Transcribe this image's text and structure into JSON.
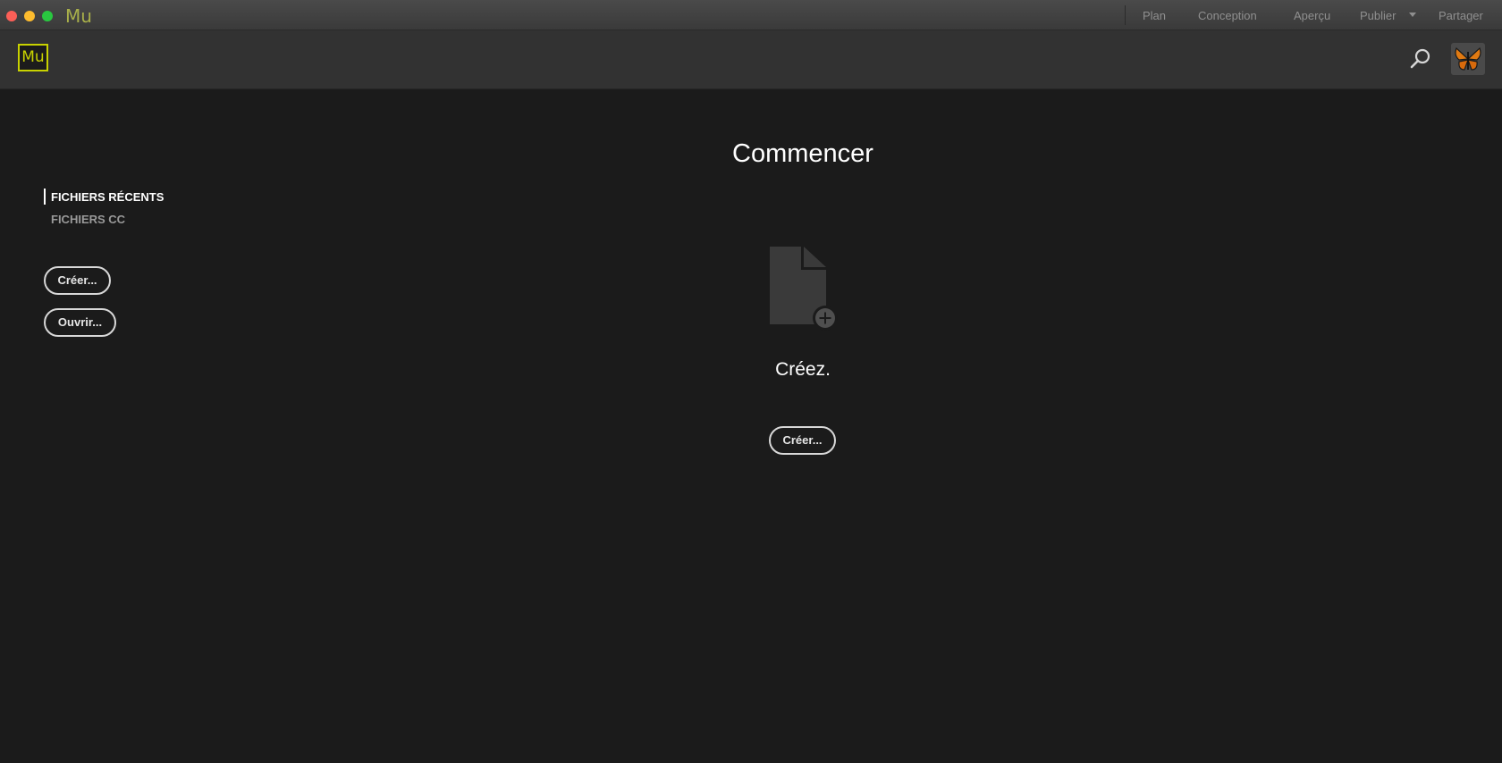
{
  "titlebar": {
    "app_name": "Mu",
    "modes": [
      "Plan",
      "Conception",
      "Aperçu",
      "Publier",
      "Partager"
    ]
  },
  "header": {
    "logo_text": "Mu"
  },
  "sidebar": {
    "tabs": [
      "FICHIERS RÉCENTS",
      "FICHIERS CC"
    ],
    "create_label": "Créer...",
    "open_label": "Ouvrir..."
  },
  "main": {
    "title": "Commencer",
    "subtitle": "Créez.",
    "create_label": "Créer..."
  },
  "colors": {
    "background": "#1b1b1b",
    "header": "#323232",
    "brand": "#c8d200"
  },
  "icons": [
    "search-icon",
    "new-document-icon",
    "plus-icon",
    "butterfly-avatar"
  ]
}
